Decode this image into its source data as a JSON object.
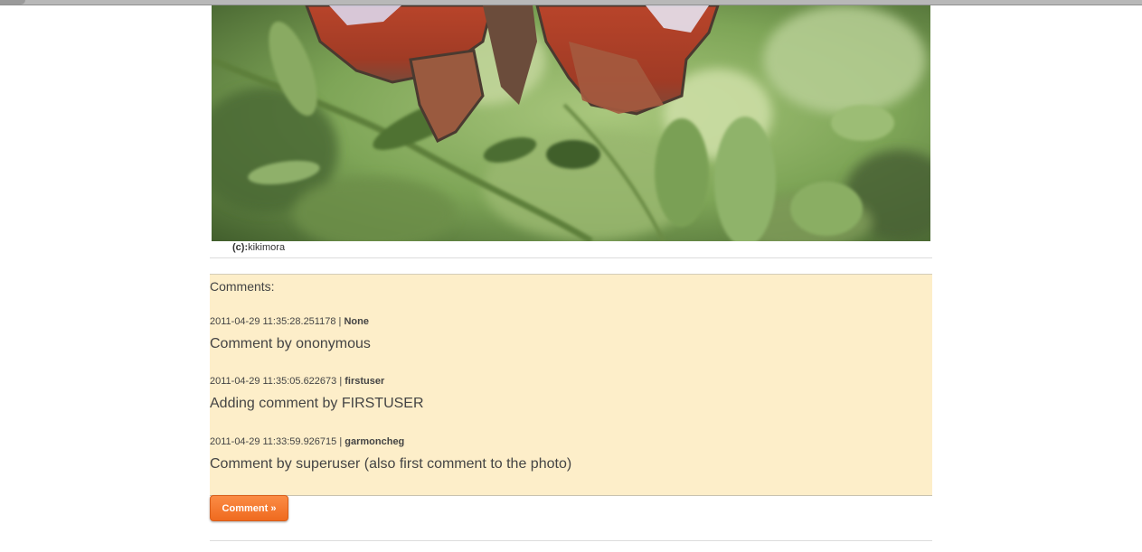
{
  "photo": {
    "credit_prefix": "(c):",
    "credit_author": "kikimora"
  },
  "comments": {
    "heading": "Comments:",
    "items": [
      {
        "timestamp": "2011-04-29 11:35:28.251178",
        "separator": " | ",
        "author": "None",
        "text": "Comment by ononymous"
      },
      {
        "timestamp": "2011-04-29 11:35:05.622673",
        "separator": " | ",
        "author": "firstuser",
        "text": "Adding comment by FIRSTUSER"
      },
      {
        "timestamp": "2011-04-29 11:33:59.926715",
        "separator": " | ",
        "author": "garmoncheg",
        "text": "Comment by superuser (also first comment to the photo)"
      }
    ]
  },
  "actions": {
    "comment_label": "Comment »"
  }
}
